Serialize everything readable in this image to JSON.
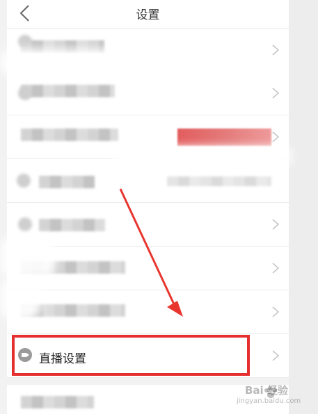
{
  "header": {
    "title": "设置"
  },
  "items": [
    {
      "label": "直播设置"
    }
  ],
  "watermark": {
    "brand": "Bai 经验",
    "url": "jingyan.baidu.com"
  },
  "colors": {
    "highlight": "#e52f2f",
    "arrow": "#e8362f",
    "background": "#f2f2f2"
  }
}
